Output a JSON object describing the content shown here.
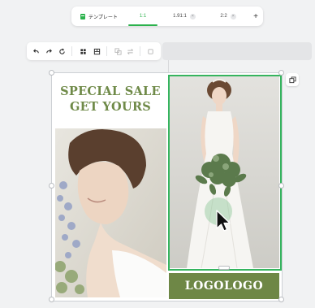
{
  "tabs": {
    "template_label": "テンプレート",
    "ratios": [
      {
        "label": "1:1",
        "active": true
      },
      {
        "label": "1.91:1",
        "active": false
      },
      {
        "label": "2:2",
        "active": false
      }
    ],
    "close_glyph": "×",
    "add_glyph": "+"
  },
  "toolbar": {
    "icons": [
      "undo-icon",
      "redo-icon",
      "refresh-icon",
      "grid-icon",
      "layout-icon",
      "ungroup-icon",
      "swap-icon",
      "lock-icon"
    ]
  },
  "design": {
    "headline_line1": "SPECIAL SALE",
    "headline_line2": "GET YOURS",
    "logo_text": "LOGOLOGO"
  },
  "colors": {
    "accent": "#2bb24c",
    "olive": "#6e8746",
    "selection": "#35b45e"
  }
}
